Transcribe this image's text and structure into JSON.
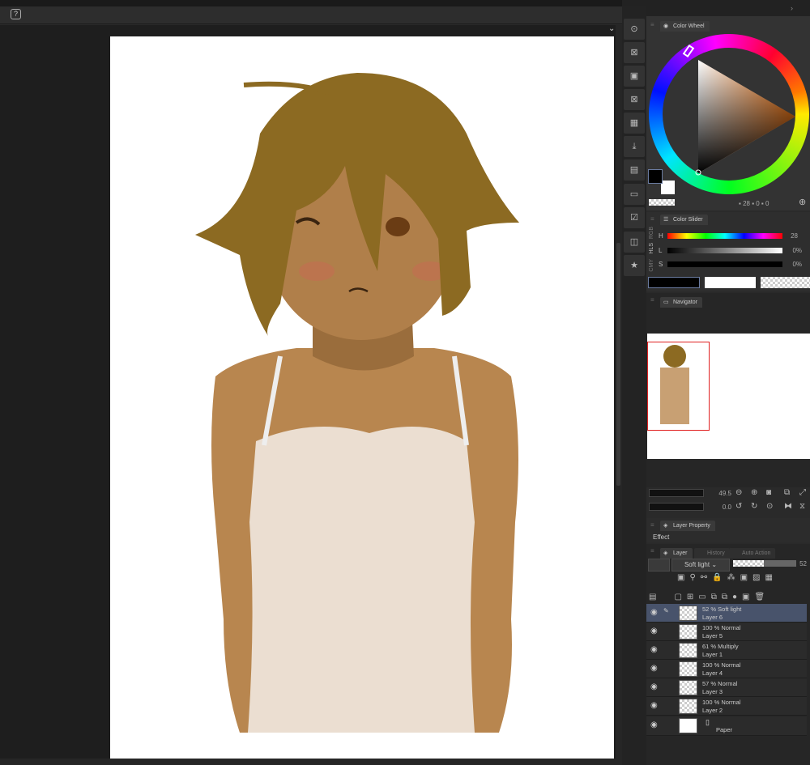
{
  "toolbar": {
    "help_icon": "help-icon",
    "collapse": "⌄"
  },
  "right_header": {
    "left": "‹   »",
    "right": "›"
  },
  "color_wheel": {
    "tab": "Color Wheel",
    "h": "28",
    "s": "0",
    "v": "0",
    "main_color": "#000000",
    "sub_color": "#ffffff"
  },
  "color_slider": {
    "tab": "Color Slider",
    "modes": [
      "RGB",
      "HLS",
      "CMY"
    ],
    "h_label": "H",
    "h_value": "28",
    "l_label": "L",
    "l_value": "0%",
    "s_label": "S",
    "s_value": "0%"
  },
  "navigator": {
    "tab": "Navigator",
    "zoom": "49.5",
    "rotation": "0.0"
  },
  "layer_property": {
    "tab": "Layer Property",
    "effect_label": "Effect"
  },
  "layer_panel": {
    "tabs": [
      "Layer",
      "History",
      "Auto Action"
    ],
    "blend_mode": "Soft light",
    "opacity": "52",
    "layers": [
      {
        "mode": "52 % Soft light",
        "name": "Layer 6",
        "selected": true
      },
      {
        "mode": "100 % Normal",
        "name": "Layer 5"
      },
      {
        "mode": "61 % Multiply",
        "name": "Layer 1"
      },
      {
        "mode": "100 % Normal",
        "name": "Layer 4"
      },
      {
        "mode": "57 % Normal",
        "name": "Layer 3"
      },
      {
        "mode": "100 % Normal",
        "name": "Layer 2"
      }
    ],
    "paper": "Paper"
  },
  "colors": {
    "skin": "#b8864f",
    "hair": "#8c6a22",
    "accent": "#48536b"
  }
}
